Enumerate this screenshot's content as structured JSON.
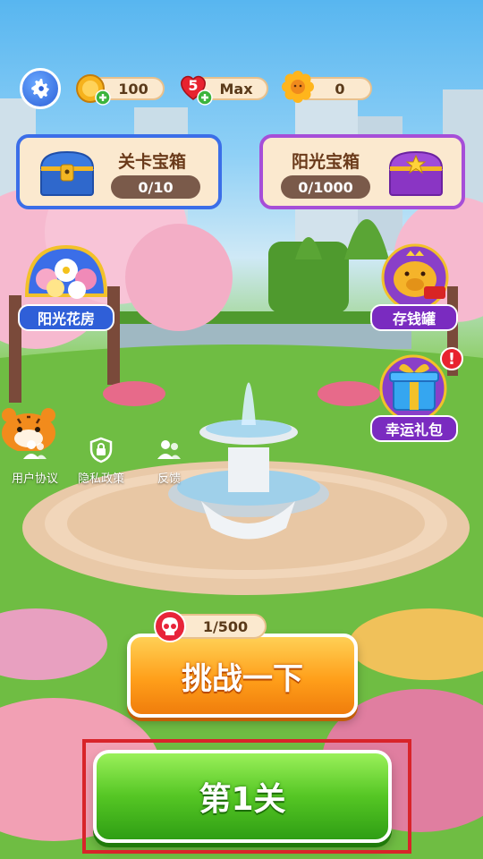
{
  "top_bar": {
    "coins": "100",
    "lives_badge": "5",
    "lives": "Max",
    "sun": "0"
  },
  "chests": {
    "level_chest": {
      "title": "关卡宝箱",
      "progress": "0/10"
    },
    "sun_chest": {
      "title": "阳光宝箱",
      "progress": "0/1000"
    }
  },
  "side": {
    "flower_house": "阳光花房",
    "piggy_bank": "存钱罐",
    "lucky_gift": "幸运礼包",
    "gift_alert": "!"
  },
  "links": {
    "user_agreement": "用户协议",
    "privacy_policy": "隐私政策",
    "feedback": "反馈"
  },
  "challenge": {
    "count": "1/500",
    "label": "挑战一下"
  },
  "level_button": {
    "label": "第1关"
  },
  "colors": {
    "accent_orange": "#ff9f1a",
    "accent_green": "#55c624",
    "panel_blue": "#3b6ee8",
    "panel_purple": "#a64ed8"
  }
}
